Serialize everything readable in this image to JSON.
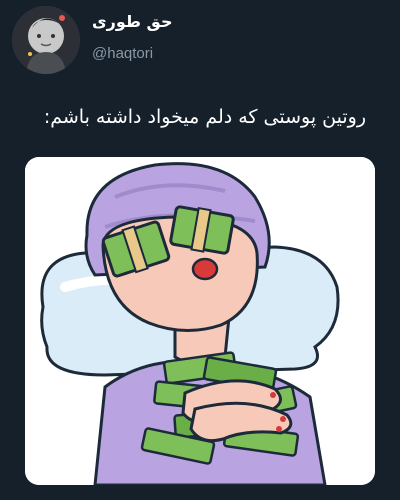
{
  "author": {
    "display_name": "حق طوری",
    "handle": "@haqtori",
    "avatar_icon": "profile-photo"
  },
  "tweet": {
    "text": "روتین پوستی که دلم میخواد داشته باشم:"
  },
  "media": {
    "icon": "cartoon-woman-with-money-illustration"
  },
  "colors": {
    "background": "#15202b",
    "text_primary": "#ffffff",
    "text_secondary": "#8b98a5",
    "turban": "#b9a3e0",
    "pillow": "#d9ecf7",
    "money": "#7fbf5a",
    "lips": "#d83a3a"
  }
}
